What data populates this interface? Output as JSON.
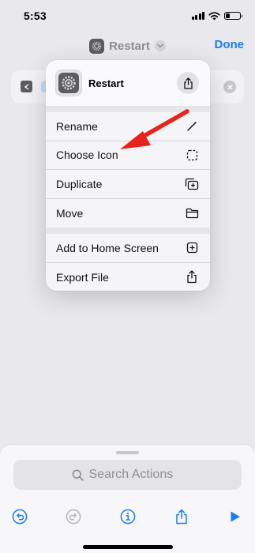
{
  "status": {
    "time": "5:53"
  },
  "nav": {
    "title": "Restart",
    "done_label": "Done"
  },
  "menu": {
    "header_title": "Restart",
    "items_group1": [
      {
        "label": "Rename",
        "icon": "pencil-icon"
      },
      {
        "label": "Choose Icon",
        "icon": "dashed-square-icon"
      },
      {
        "label": "Duplicate",
        "icon": "plus-square-stack-icon"
      },
      {
        "label": "Move",
        "icon": "folder-icon"
      }
    ],
    "items_group2": [
      {
        "label": "Add to Home Screen",
        "icon": "plus-square-icon"
      },
      {
        "label": "Export File",
        "icon": "share-icon"
      }
    ]
  },
  "search": {
    "placeholder": "Search Actions"
  },
  "colors": {
    "accent": "#1a7cf5",
    "annotation_arrow": "#e8221c",
    "icon_gray": "#5c5c61"
  }
}
